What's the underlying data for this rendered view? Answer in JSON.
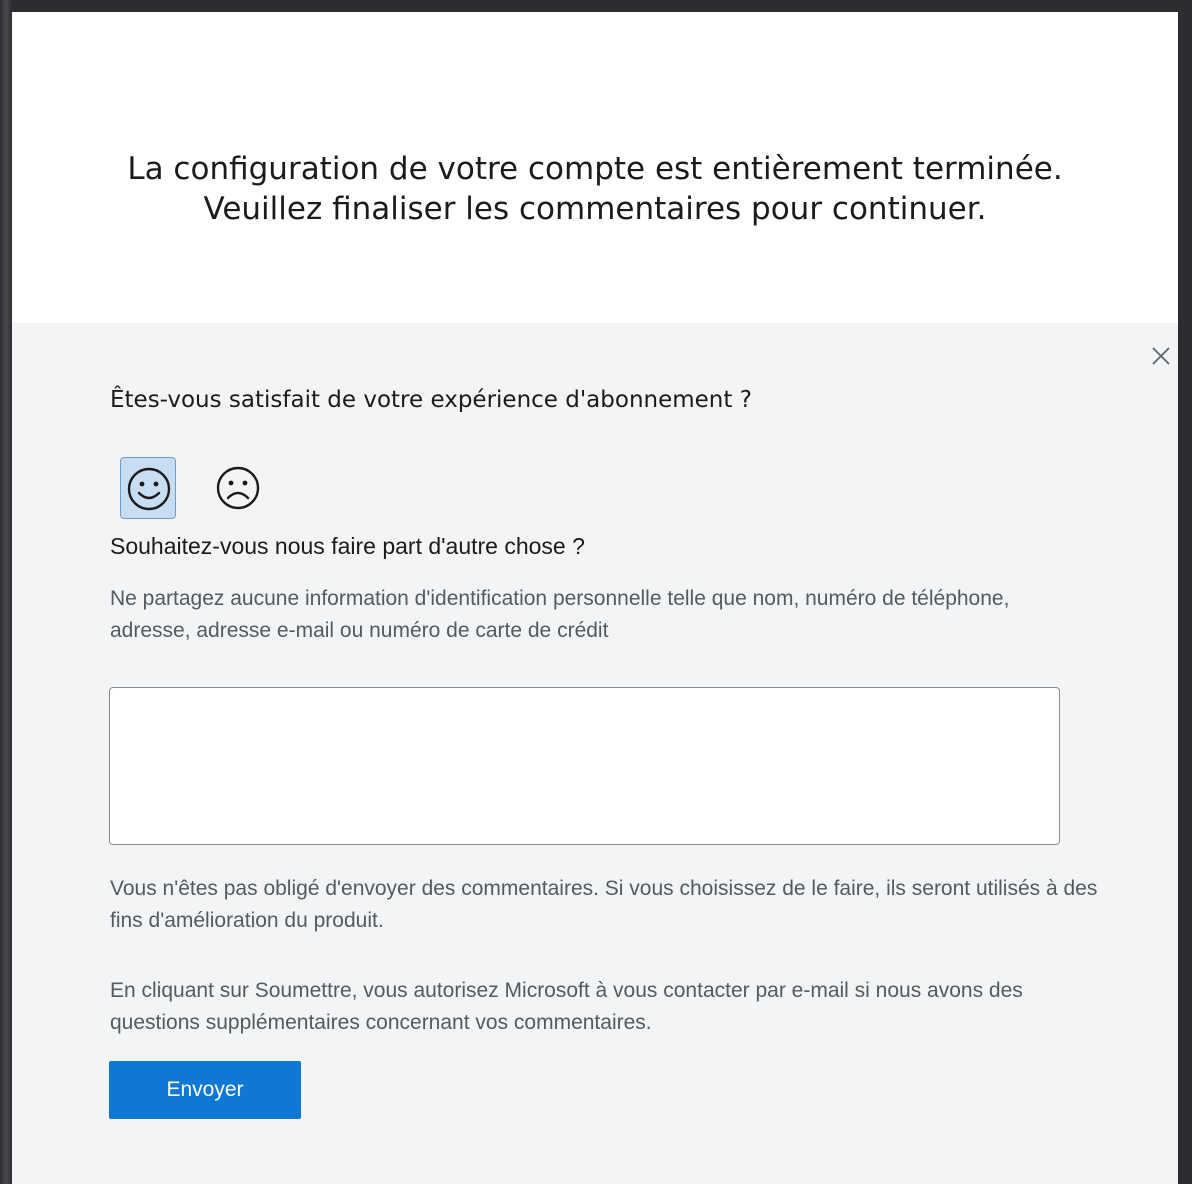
{
  "banner": {
    "line1": "La configuration de votre compte est entièrement terminée.",
    "line2": "Veuillez finaliser les commentaires pour continuer."
  },
  "feedback": {
    "close_icon": "close-icon",
    "satisfaction_question": "Êtes-vous satisfait de votre expérience d'abonnement ?",
    "options": [
      {
        "icon": "smiley-happy-icon",
        "selected": true
      },
      {
        "icon": "smiley-sad-icon",
        "selected": false
      }
    ],
    "other_question": "Souhaitez-vous nous faire part d'autre chose ?",
    "privacy_note": "Ne partagez aucune information d'identification personnelle telle que nom, numéro de téléphone, adresse, adresse e-mail ou numéro de carte de crédit",
    "comment_value": "",
    "optional_note": "Vous n'êtes pas obligé d'envoyer des commentaires. Si vous choisissez de le faire, ils seront utilisés à des fins d'amélioration du produit.",
    "consent_note": "En cliquant sur Soumettre, vous autorisez Microsoft à vous contacter par e-mail si nous avons des questions supplémentaires concernant vos commentaires.",
    "submit_label": "Envoyer"
  },
  "colors": {
    "accent": "#0f78d4",
    "panel_bg": "#f3f4f6",
    "selected_bg": "#c8ddf1"
  }
}
